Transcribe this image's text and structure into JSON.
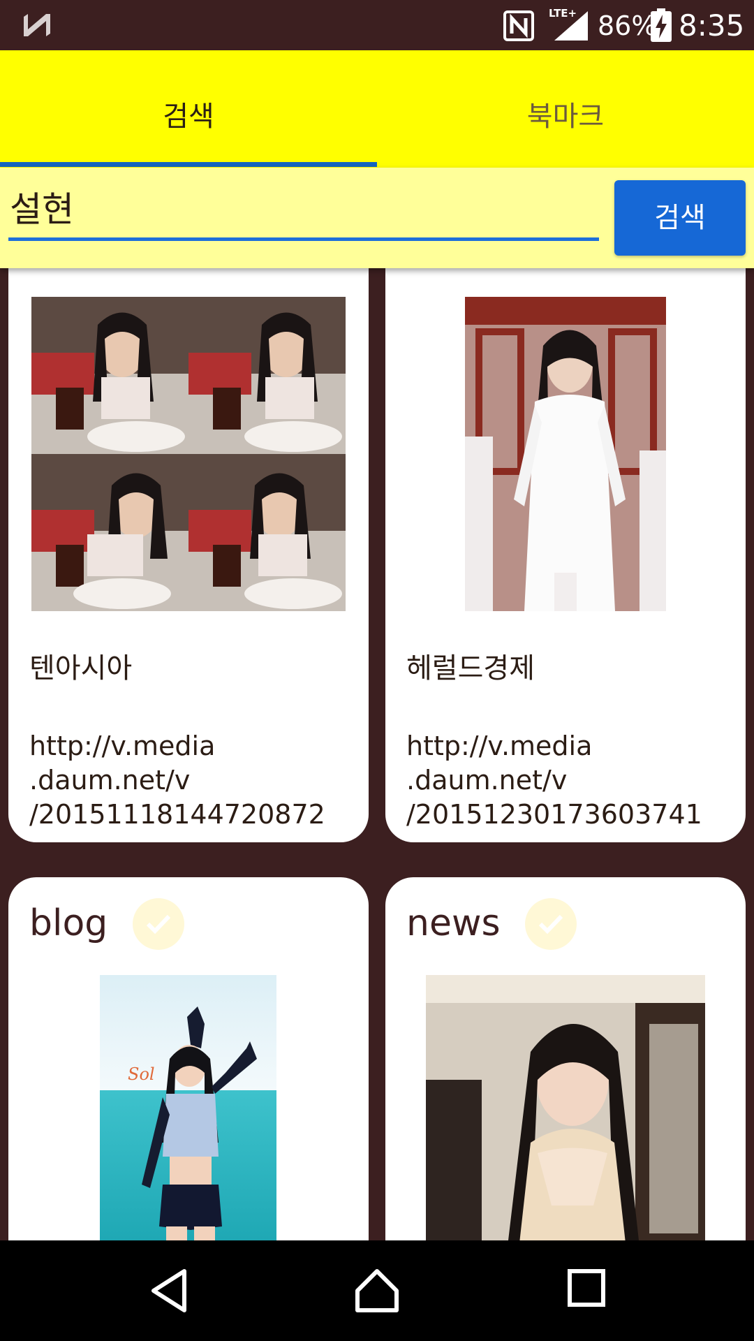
{
  "status_bar": {
    "battery": "86%",
    "time": "8:35",
    "network": "LTE+",
    "icons": [
      "n-logo-icon",
      "nfc-icon",
      "lte-signal-icon",
      "battery-charging-icon"
    ]
  },
  "tabs": [
    {
      "label": "검색",
      "active": true
    },
    {
      "label": "북마크",
      "active": false
    }
  ],
  "search": {
    "value": "설현",
    "button_label": "검색"
  },
  "cards": [
    {
      "source": "텐아시아",
      "url_lines": [
        "http://v.media",
        ".daum.net/v",
        "/20151118144720872"
      ]
    },
    {
      "source": "헤럴드경제",
      "url_lines": [
        "http://v.media",
        ".daum.net/v",
        "/20151230173603741"
      ]
    },
    {
      "title": "blog",
      "check_icon": "check-icon"
    },
    {
      "title": "news",
      "check_icon": "check-icon"
    }
  ],
  "nav_bar": {
    "icons": [
      "back-icon",
      "home-icon",
      "recents-icon"
    ]
  },
  "colors": {
    "background": "#3c1f20",
    "tab_bar": "#ffff00",
    "search_bar": "#ffff99",
    "accent_blue": "#1668d6",
    "card": "#ffffff"
  }
}
